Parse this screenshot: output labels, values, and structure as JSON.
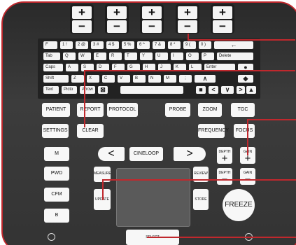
{
  "tgc_sliders": [
    {
      "plus": "+",
      "minus": "−"
    },
    {
      "plus": "+",
      "minus": "−"
    },
    {
      "plus": "+",
      "minus": "−"
    },
    {
      "plus": "+",
      "minus": "−"
    },
    {
      "plus": "+",
      "minus": "−"
    }
  ],
  "keyboard": {
    "row1": [
      "F",
      "1 !",
      "2 @",
      "3 #",
      "4 $",
      "5 %",
      "6 ^",
      "7 &",
      "8 *",
      "9 (",
      "0 )",
      "←"
    ],
    "row2": [
      "Tab",
      "Q",
      "W",
      "E",
      "R",
      "T",
      "Y",
      "U",
      "I",
      "O",
      "P",
      "Delete"
    ],
    "row3": [
      "Caps",
      "A",
      "S",
      "D",
      "F",
      "G",
      "H",
      "J",
      "K",
      "L",
      "Enter",
      "●"
    ],
    "row4": [
      "Shift",
      "Z",
      "X",
      "C",
      "V",
      "B",
      "N",
      "M",
      ";",
      "∧",
      "◆"
    ],
    "row5": [
      "Text",
      "Picto",
      "Arrow",
      "⊠",
      "",
      "■",
      "<",
      "∨",
      ">",
      "▲"
    ]
  },
  "controls": {
    "patient": "PATIENT",
    "report": "REPORT",
    "protocol": "PROTOCOL",
    "probe": "PROBE",
    "zoom": "ZOOM",
    "tgc": "TGC",
    "settings": "SETTINGS",
    "clear": "CLEAR",
    "frequency": "FREQUENCY",
    "focus": "FOCUS",
    "m": "M",
    "pwd": "PWD",
    "cfm": "CFM",
    "b": "B",
    "cineloop": "CINELOOP",
    "cine_left": "<",
    "cine_right": ">",
    "depth": "DEPTH",
    "gain": "GAIN",
    "plus": "+",
    "minus": "−",
    "measure": "MEASURE",
    "update": "UPDATE",
    "review": "REVIEW",
    "store": "STORE",
    "freeze": "FREEZE",
    "select": "SELECT"
  },
  "colors": {
    "panel": "#333333",
    "key": "#f4f4f4",
    "annotation": "#c0282d"
  }
}
